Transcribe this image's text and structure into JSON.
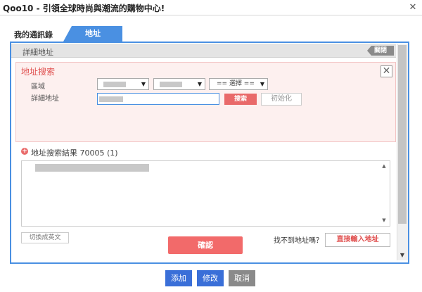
{
  "window": {
    "title": "Qoo10 - 引領全球時尚與潮流的購物中心!",
    "close_glyph": "✕"
  },
  "tabs": [
    {
      "label": "我的通訊錄",
      "active": false
    },
    {
      "label": "地址",
      "active": true
    }
  ],
  "detail": {
    "label": "詳細地址",
    "close_label": "關閉"
  },
  "search": {
    "title": "地址搜索",
    "close_glyph": "✕",
    "region_label": "區域",
    "detail_label": "詳細地址",
    "select3_value": "== 選擇 ==",
    "search_button": "搜索",
    "reset_button": "初始化"
  },
  "results": {
    "icon_glyph": "+",
    "title": "地址搜索結果 70005 (1)"
  },
  "actions": {
    "english_button": "切換成英文",
    "confirm_button": "確認",
    "not_found_text": "找不到地址嗎？",
    "direct_input_button": "直接輸入地址"
  },
  "footer": {
    "add": "添加",
    "edit": "修改",
    "cancel": "取消"
  },
  "colors": {
    "accent_blue": "#4a90e2",
    "accent_red": "#e96a6a",
    "button_blue": "#3a6fd8",
    "button_gray": "#8a8a8a"
  }
}
